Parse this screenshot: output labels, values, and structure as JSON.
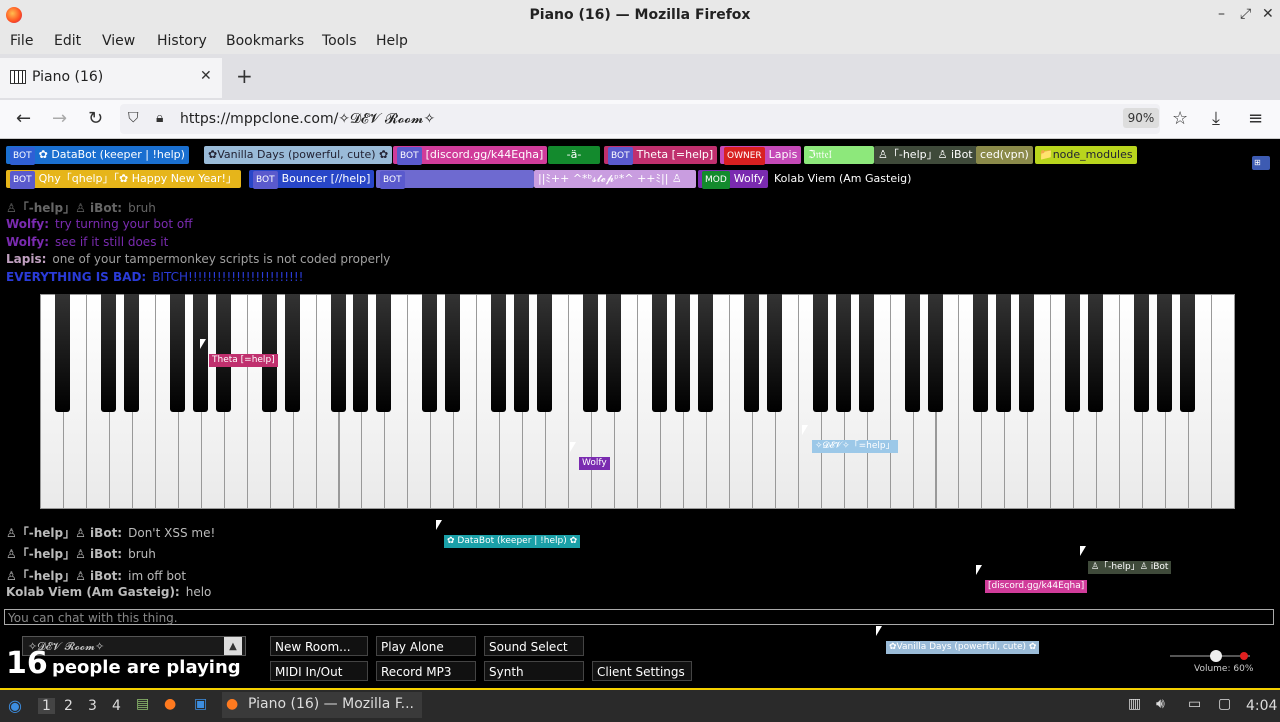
{
  "window": {
    "title": "Piano (16) — Mozilla Firefox"
  },
  "menu": [
    "File",
    "Edit",
    "View",
    "History",
    "Bookmarks",
    "Tools",
    "Help"
  ],
  "tab": {
    "label": "Piano (16)"
  },
  "url": "https://mppclone.com/✧𝓓𝓔𝓥 𝓡𝓸𝓸𝓶✧",
  "zoom": "90%",
  "users_row1": [
    {
      "badge": "BOT",
      "name": "✿ DataBot (keeper | !help)",
      "bg": "#1a6fd0"
    },
    {
      "badge": "",
      "name": "✿Vanilla Days (powerful, cute) ✿",
      "bg": "#9abbd8"
    },
    {
      "badge": "BOT",
      "name": "[discord.gg/k44Eqha]",
      "bg": "#d03c9a"
    },
    {
      "badge": "",
      "name": "-ä-",
      "bg": "#138a2d"
    },
    {
      "badge": "BOT",
      "name": "Theta [=help]",
      "bg": "#c0306e"
    },
    {
      "badge": "OWNER",
      "name": "Lapis",
      "bg": "#c54ab8"
    },
    {
      "badge": "",
      "name": "ℑ𝔫𝔱𝔢𝔩",
      "bg": "#8de87b"
    },
    {
      "badge": "",
      "name": "♙「-help」♙ iBot",
      "bg": "#3f4a3a"
    },
    {
      "badge": "",
      "name": "ced(vpn)",
      "bg": "#8b8a4a"
    },
    {
      "badge": "",
      "name": "📁node_modules",
      "bg": "#b9d51d"
    }
  ],
  "users_row2": [
    {
      "badge": "BOT",
      "name": "Qhy「qhelp」「✿ Happy New Year!」",
      "bg": "#e6b51a"
    },
    {
      "badge": "BOT",
      "name": "Bouncer [//help]",
      "bg": "#2846c8"
    },
    {
      "badge": "BOT",
      "name": "",
      "bg": "#6e6ad0"
    },
    {
      "badge": "",
      "name": "||ﾐ++ ^*ᵇ𝓼𝓽𝓮𝓹ᵖ*^ ++ﾐ|| ♙",
      "bg": "#c99de0"
    },
    {
      "badge": "MOD",
      "name": "Wolfy",
      "bg": "#7a2bb0"
    },
    {
      "badge": "",
      "name": "Kolab Viem (Am Gasteig)",
      "bg": "#000"
    }
  ],
  "chat_top": [
    {
      "name": "♙「-help」♙ iBot:",
      "msg": "bruh",
      "color": "#666"
    },
    {
      "name": "Wolfy:",
      "msg": "try turning your bot off",
      "color": "#7a2bb0"
    },
    {
      "name": "Wolfy:",
      "msg": "see if it still does it",
      "color": "#7a2bb0"
    },
    {
      "name": "Lapis:",
      "msg": "one of your tampermonkey scripts is not coded properly",
      "color": "#c0a0c0"
    },
    {
      "name": "EVERYTHING IS BAD:",
      "msg": "BITCH!!!!!!!!!!!!!!!!!!!!!!!!",
      "color": "#2a3bd8"
    }
  ],
  "chat_bottom": [
    {
      "name": "♙「-help」♙ iBot:",
      "msg": "Don't XSS me!",
      "color": "#bbb"
    },
    {
      "name": "♙「-help」♙ iBot:",
      "msg": "bruh",
      "color": "#bbb"
    },
    {
      "name": "♙「-help」♙ iBot:",
      "msg": "im off bot",
      "color": "#bbb"
    },
    {
      "name": "Kolab Viem (Am Gasteig):",
      "msg": "helo",
      "color": "#bbb"
    }
  ],
  "cursors": [
    {
      "label": "Theta [=help]",
      "bg": "#c0306e"
    },
    {
      "label": "Wolfy",
      "bg": "#7a2bb0"
    },
    {
      "label": "✧𝓓𝓔𝓥✧「=help」",
      "bg": "#9cc8e8"
    },
    {
      "label": "✿ DataBot (keeper | !help) ✿",
      "bg": "#1aa0a8"
    },
    {
      "label": "♙「-help」♙ iBot",
      "bg": "#3f4a3a"
    },
    {
      "label": "[discord.gg/k44Eqha]",
      "bg": "#d03c9a"
    },
    {
      "label": "✿Vanilla Days (powerful, cute) ✿",
      "bg": "#9abbd8"
    }
  ],
  "chat_placeholder": "You can chat with this thing.",
  "room_name": "✧𝓓𝓔𝓥 𝓡𝓸𝓸𝓶✧",
  "player_count": "16",
  "player_text": "people are playing",
  "buttons": {
    "new_room": "New Room...",
    "play_alone": "Play Alone",
    "sound_select": "Sound Select",
    "midi": "MIDI In/Out",
    "record": "Record MP3",
    "synth": "Synth",
    "client_settings": "Client Settings"
  },
  "volume": "Volume: 60%",
  "taskbar": {
    "workspaces": [
      "1",
      "2",
      "3",
      "4"
    ],
    "window": "Piano (16) — Mozilla F...",
    "clock": "4:04"
  }
}
